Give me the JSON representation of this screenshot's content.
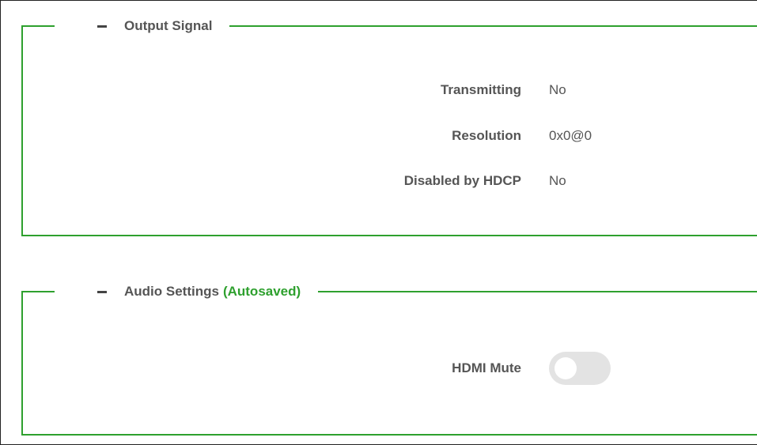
{
  "output_signal": {
    "collapse_symbol": "—",
    "title": "Output Signal",
    "rows": [
      {
        "label": "Transmitting",
        "value": "No"
      },
      {
        "label": "Resolution",
        "value": "0x0@0"
      },
      {
        "label": "Disabled by HDCP",
        "value": "No"
      }
    ]
  },
  "audio_settings": {
    "title": "Audio Settings",
    "autosaved": "(Autosaved)",
    "hdmi_mute": {
      "label": "HDMI Mute",
      "state": "off"
    }
  },
  "colors": {
    "accent_green": "#2ea02e",
    "label_gray": "#555555",
    "toggle_off": "#e3e3e3"
  }
}
